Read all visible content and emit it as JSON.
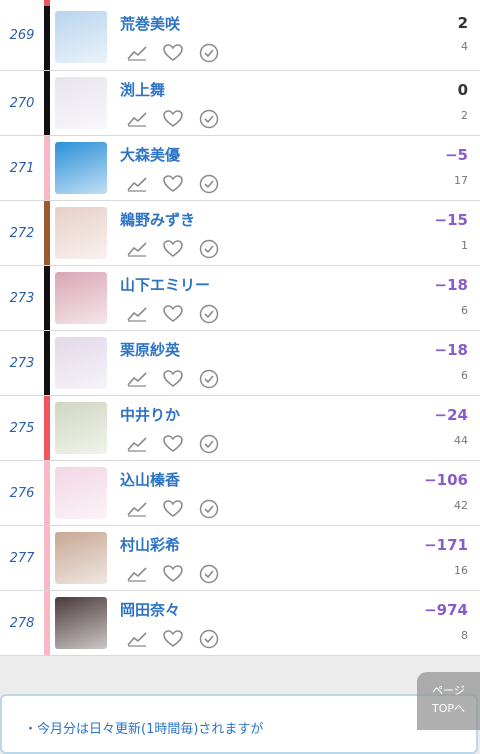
{
  "rows": [
    {
      "rank": "269",
      "name": "荒巻美咲",
      "value": "2",
      "value_color": "#333333",
      "sub": "4",
      "bar_color": "#111111"
    },
    {
      "rank": "270",
      "name": "渕上舞",
      "value": "0",
      "value_color": "#333333",
      "sub": "2",
      "bar_color": "#111111"
    },
    {
      "rank": "271",
      "name": "大森美優",
      "value": "−5",
      "value_color": "#8a5cc9",
      "sub": "17",
      "bar_color": "#f6b9c4"
    },
    {
      "rank": "272",
      "name": "鵜野みずき",
      "value": "−15",
      "value_color": "#8a5cc9",
      "sub": "1",
      "bar_color": "#9b5a2e"
    },
    {
      "rank": "273",
      "name": "山下エミリー",
      "value": "−18",
      "value_color": "#8a5cc9",
      "sub": "6",
      "bar_color": "#111111"
    },
    {
      "rank": "273",
      "name": "栗原紗英",
      "value": "−18",
      "value_color": "#8a5cc9",
      "sub": "6",
      "bar_color": "#111111"
    },
    {
      "rank": "275",
      "name": "中井りか",
      "value": "−24",
      "value_color": "#8a5cc9",
      "sub": "44",
      "bar_color": "#f0555d"
    },
    {
      "rank": "276",
      "name": "込山榛香",
      "value": "−106",
      "value_color": "#8a5cc9",
      "sub": "42",
      "bar_color": "#f6b9c4"
    },
    {
      "rank": "277",
      "name": "村山彩希",
      "value": "−171",
      "value_color": "#8a5cc9",
      "sub": "16",
      "bar_color": "#f6b9c4"
    },
    {
      "rank": "278",
      "name": "岡田奈々",
      "value": "−974",
      "value_color": "#8a5cc9",
      "sub": "8",
      "bar_color": "#f6b9c4"
    }
  ],
  "thumbs": [
    "#b8d4ee",
    "#e8e4ee",
    "#2a8fd8",
    "#e7cfc8",
    "#d9a6b4",
    "#e2d8e8",
    "#cfd6c0",
    "#f2d6e4",
    "#c8a894",
    "#4a3a3a"
  ],
  "info": {
    "text": "・今月分は日々更新(1時間毎)されますが"
  },
  "totop": {
    "line1": "ページ",
    "line2": "TOPへ"
  },
  "icons": {
    "chart": "line-chart-icon",
    "heart": "heart-icon",
    "check": "check-circle-icon"
  }
}
